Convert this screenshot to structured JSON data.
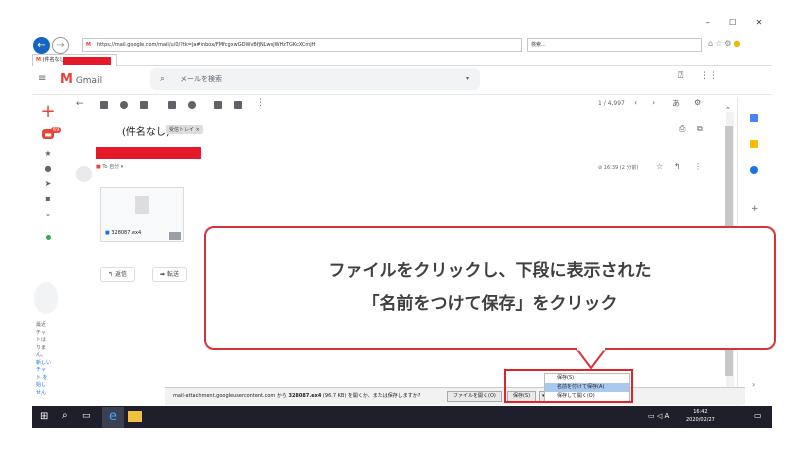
{
  "browser": {
    "url": "https://mail.google.com/mail/u/0/?tk=ja#inbox/FMfcgxwGDWvBfjNLwsjWHzTGKcXCmJH",
    "search_placeholder": "検索...",
    "tab_label": "(件名なし)",
    "window_controls": [
      "–",
      "☐",
      "✕"
    ]
  },
  "gmail": {
    "app_name": "Gmail",
    "search_placeholder": "メールを検索",
    "pagination": "1 / 4,997",
    "lang_btn": "あ",
    "subject": "(件名なし)",
    "label_chip": "受信トレイ ×",
    "to_me": "To 自分",
    "time": "16:39 (2 分前)",
    "attachment_name": "328087.ex4",
    "reply_label": "返信",
    "forward_label": "転送",
    "unread_badge": "69"
  },
  "left_notes": [
    "最近",
    "チャ",
    "トは",
    "りま",
    "ん。",
    "新しい",
    "チャ",
    "ト を",
    "始し",
    "せん"
  ],
  "download_bar": {
    "message_prefix": "mail-attachment.googleusercontent.com から ",
    "file": "328087.ex4",
    "message_suffix": " (96.7 KB) を開くか、または保存しますか?",
    "open_label": "ファイルを開く(O)",
    "save_label": "保存(S)",
    "menu_items": [
      "保存(S)",
      "名前を付けて保存(A)",
      "保存して開く(O)"
    ]
  },
  "taskbar": {
    "time": "16:42",
    "date": "2020/02/27",
    "ime": "A"
  },
  "callout": {
    "line1": "ファイルをクリックし、下段に表示された",
    "line2": "「名前をつけて保存」をクリック"
  },
  "colors": {
    "callout_border": "#d7333a",
    "highlight": "#e0222a",
    "gmail_red": "#ea4335",
    "taskbar": "#1f1f2b"
  }
}
